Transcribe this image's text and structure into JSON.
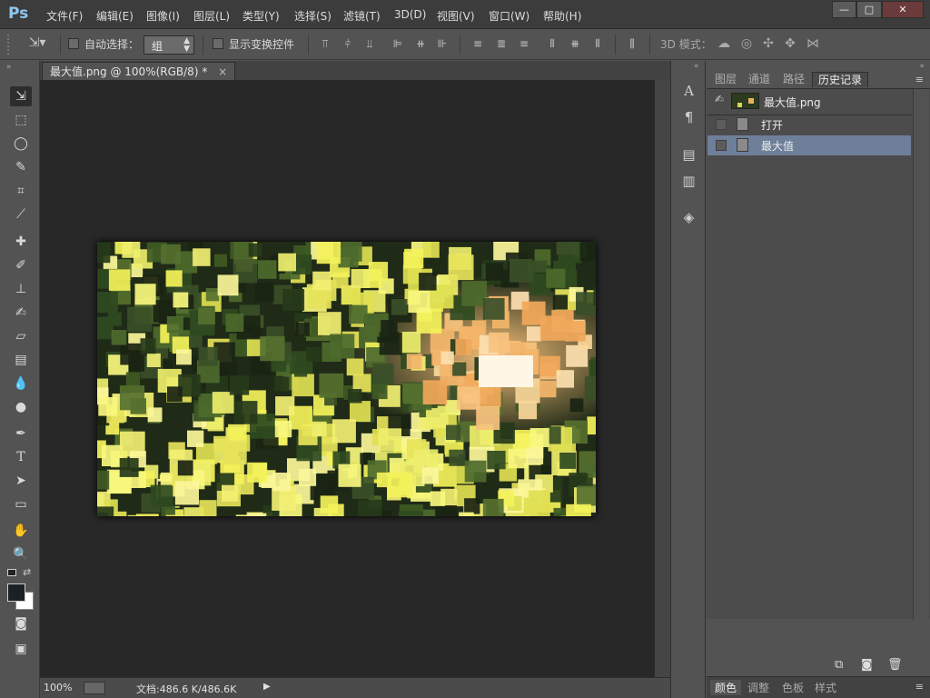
{
  "app": {
    "logo": "Ps"
  },
  "menu": [
    "文件(F)",
    "编辑(E)",
    "图像(I)",
    "图层(L)",
    "类型(Y)",
    "选择(S)",
    "滤镜(T)",
    "3D(D)",
    "视图(V)",
    "窗口(W)",
    "帮助(H)"
  ],
  "window_controls": {
    "minimize": "—",
    "maximize": "□",
    "close": "✕"
  },
  "options": {
    "auto_select_label": "自动选择：",
    "auto_select_value": "组",
    "show_transform_label": "显示变换控件",
    "mode_3d_label": "3D 模式："
  },
  "document": {
    "tab_title": "最大值.png @ 100%(RGB/8) *",
    "tab_close": "×",
    "zoom": "100%",
    "doc_size": "文档:486.6 K/486.6K"
  },
  "panel": {
    "tabs": [
      "图层",
      "通道",
      "路径",
      "历史记录"
    ],
    "active_tab": "历史记录",
    "snapshot_name": "最大值.png",
    "history": [
      {
        "label": "打开",
        "selected": false
      },
      {
        "label": "最大值",
        "selected": true
      }
    ],
    "bottom_tabs": [
      "颜色",
      "调整",
      "色板",
      "样式"
    ]
  },
  "colors": {
    "selection": "#6e7f9a",
    "accent_logo": "#8fc7f0"
  }
}
